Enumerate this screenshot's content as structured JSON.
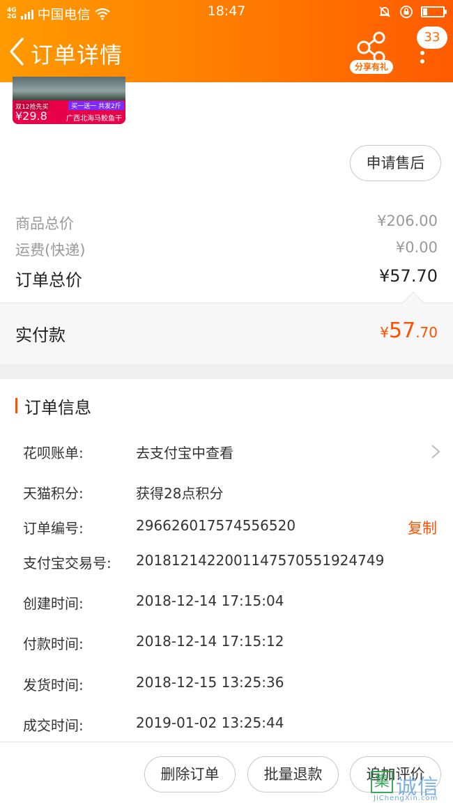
{
  "status_bar": {
    "network": "4G/2G",
    "carrier": "中国电信",
    "time": "18:47"
  },
  "header": {
    "title": "订单详情",
    "share_label": "分享有礼",
    "badge_count": "33"
  },
  "product": {
    "promo_tag": "双12抢先买",
    "price": "¥29.8",
    "offer_tag": "买一送一 共发2斤",
    "name": "广西北海马鲛鱼干"
  },
  "after_sale_button": "申请售后",
  "prices": {
    "goods_total_label": "商品总价",
    "goods_total_value": "¥206.00",
    "shipping_label": "运费(快递)",
    "shipping_value": "¥0.00",
    "order_total_label": "订单总价",
    "order_total_value": "¥57.70"
  },
  "paid": {
    "label": "实付款",
    "symbol": "¥",
    "integer": "57",
    "decimal": ".70"
  },
  "order_info": {
    "title": "订单信息",
    "rows": [
      {
        "label": "花呗账单:",
        "value": "去支付宝中查看"
      },
      {
        "label": "天猫积分:",
        "value": "获得28点积分"
      },
      {
        "label": "订单编号:",
        "value": "296626017574556520",
        "action": "复制"
      },
      {
        "label": "支付宝交易号:",
        "value": "2018121422001147570551924749"
      },
      {
        "label": "创建时间:",
        "value": "2018-12-14 17:15:04"
      },
      {
        "label": "付款时间:",
        "value": "2018-12-14 17:15:12"
      },
      {
        "label": "发货时间:",
        "value": "2018-12-15 13:25:36"
      },
      {
        "label": "成交时间:",
        "value": "2019-01-02 13:25:44"
      }
    ]
  },
  "bottom_actions": {
    "delete": "删除订单",
    "batch_refund": "批量退款",
    "add_review": "追加评价"
  },
  "watermark": {
    "logo_char": "集",
    "text": "诚信",
    "url": "JiChengXin.com"
  },
  "colors": {
    "header_gradient_start": "#ff9a00",
    "header_gradient_end": "#ff5a00",
    "accent": "#ff5000"
  }
}
